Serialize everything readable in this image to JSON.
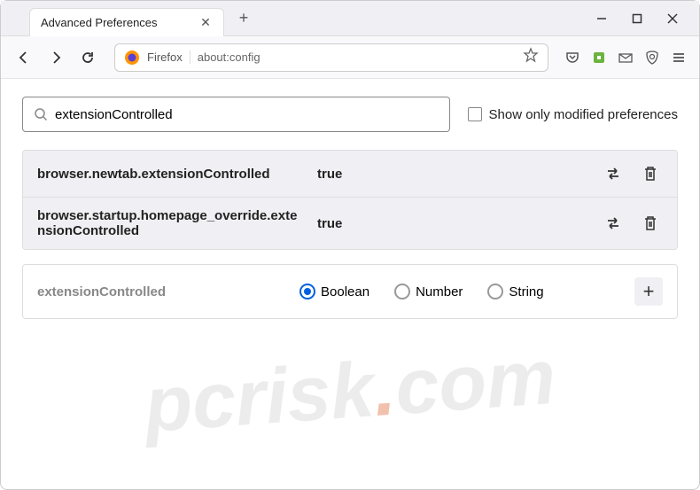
{
  "window": {
    "tab_title": "Advanced Preferences"
  },
  "urlbar": {
    "brand": "Firefox",
    "url": "about:config"
  },
  "search": {
    "value": "extensionControlled",
    "checkbox_label": "Show only modified preferences"
  },
  "preferences": [
    {
      "name": "browser.newtab.extensionControlled",
      "value": "true"
    },
    {
      "name": "browser.startup.homepage_override.extensionControlled",
      "value": "true"
    }
  ],
  "new_pref": {
    "name": "extensionControlled",
    "types": [
      "Boolean",
      "Number",
      "String"
    ],
    "selected": "Boolean"
  },
  "watermark": {
    "p1": "pcrisk",
    "p2": ".",
    "p3": "com"
  }
}
